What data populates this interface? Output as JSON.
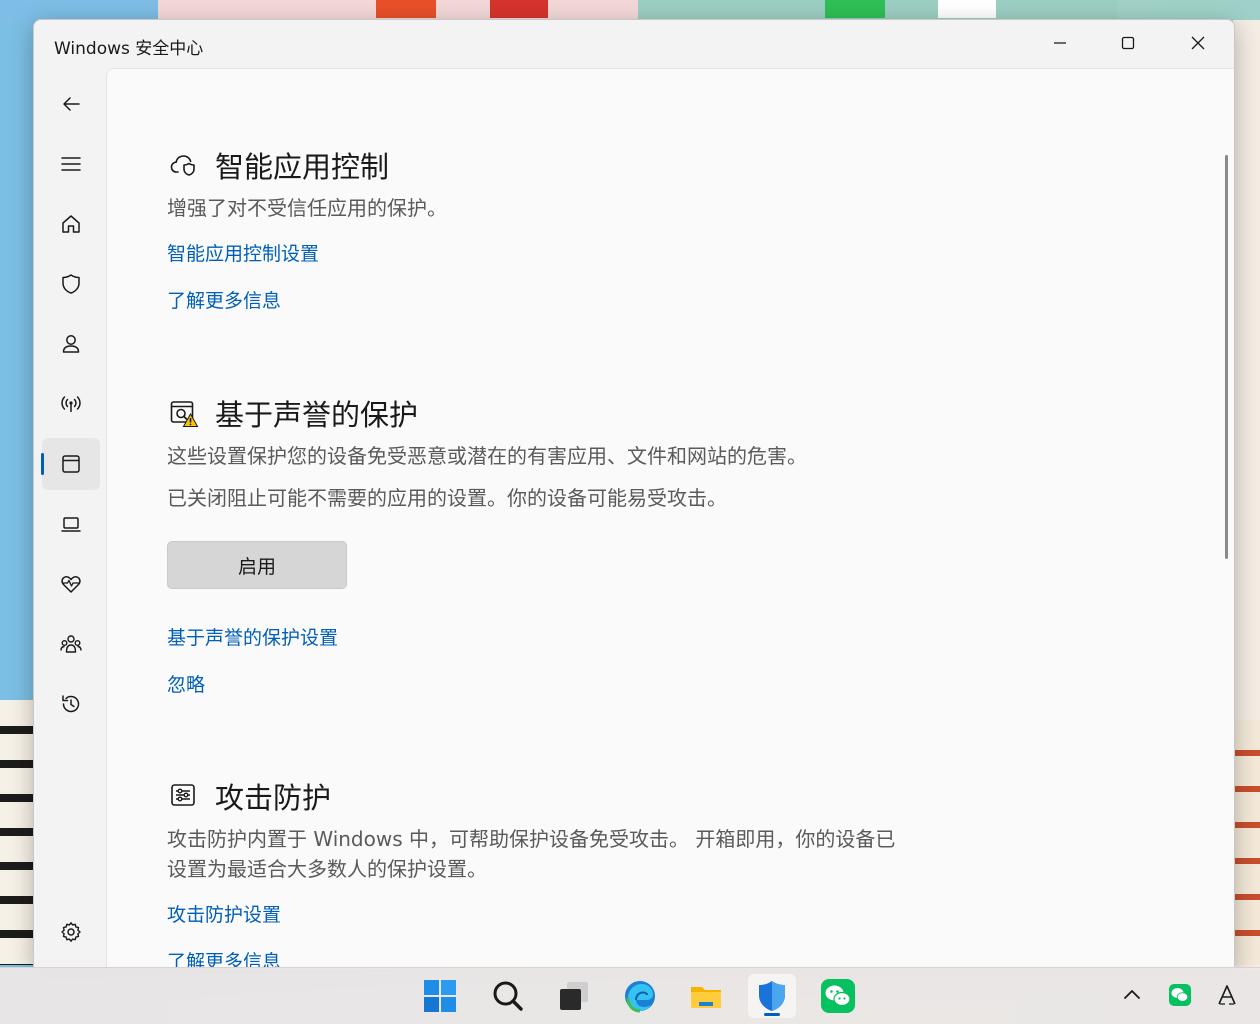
{
  "window": {
    "title": "Windows 安全中心"
  },
  "sidebar": {
    "items": [
      {
        "icon": "back-arrow-icon"
      },
      {
        "icon": "hamburger-menu-icon"
      },
      {
        "icon": "home-icon"
      },
      {
        "icon": "shield-icon"
      },
      {
        "icon": "account-icon"
      },
      {
        "icon": "wireless-antenna-icon"
      },
      {
        "icon": "app-browser-control-icon",
        "active": true
      },
      {
        "icon": "device-security-laptop-icon"
      },
      {
        "icon": "heart-pulse-icon"
      },
      {
        "icon": "family-options-icon"
      },
      {
        "icon": "history-icon"
      },
      {
        "icon": "settings-gear-icon"
      }
    ]
  },
  "sections": {
    "smart_app_control": {
      "title": "智能应用控制",
      "description": "增强了对不受信任应用的保护。",
      "settings_link": "智能应用控制设置",
      "learn_more_link": "了解更多信息"
    },
    "reputation_protection": {
      "title": "基于声誉的保护",
      "description": "这些设置保护您的设备免受恶意或潜在的有害应用、文件和网站的危害。",
      "warning": "已关闭阻止可能不需要的应用的设置。你的设备可能易受攻击。",
      "enable_button": "启用",
      "settings_link": "基于声誉的保护设置",
      "dismiss_link": "忽略"
    },
    "exploit_protection": {
      "title": "攻击防护",
      "description": "攻击防护内置于 Windows 中，可帮助保护设备免受攻击。 开箱即用，你的设备已设置为最适合大多数人的保护设置。",
      "settings_link": "攻击防护设置",
      "learn_more_link": "了解更多信息"
    }
  },
  "taskbar": {
    "apps": [
      "start-icon",
      "search-icon",
      "task-view-icon",
      "edge-icon",
      "file-explorer-icon",
      "windows-security-icon",
      "wechat-icon"
    ],
    "active_app": "windows-security-icon",
    "tray": [
      "show-hidden-icons-chevron",
      "wechat-tray-icon",
      "input-method-icon"
    ],
    "colors": {
      "accent": "#005fb8",
      "wechat": "#07c160"
    }
  }
}
